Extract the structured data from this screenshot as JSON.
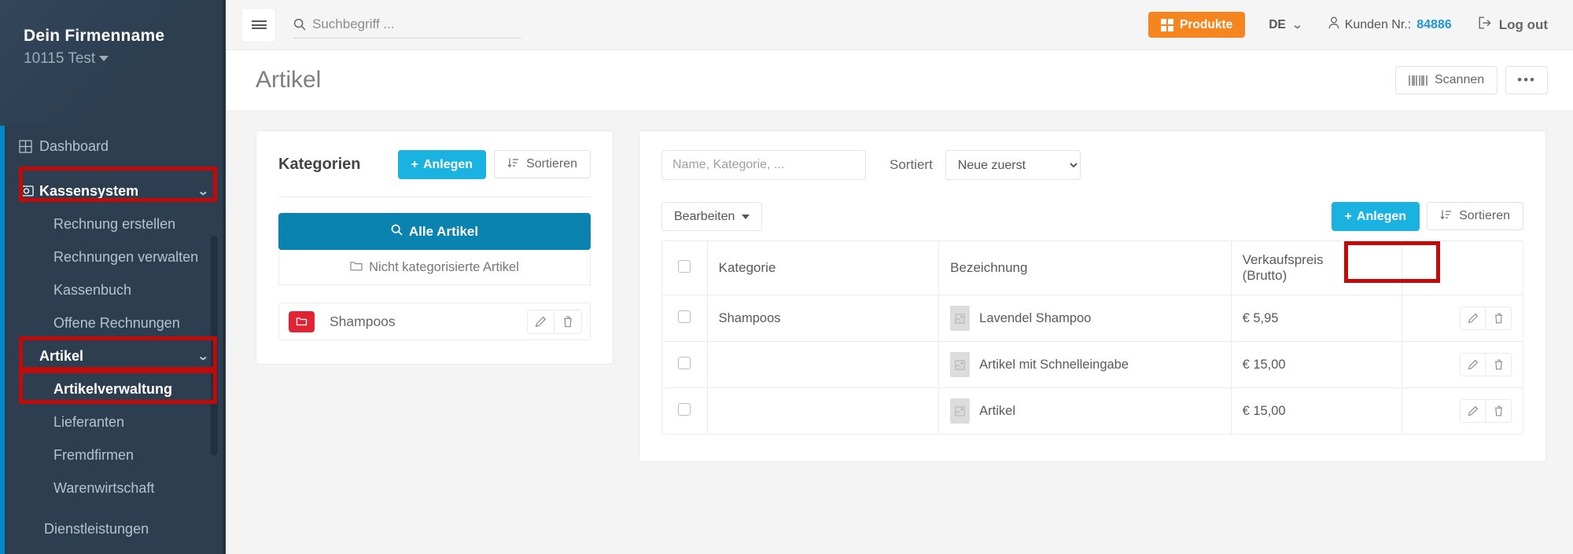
{
  "sidebar": {
    "brand_name": "Dein Firmenname",
    "brand_sub": "10115 Test",
    "items": [
      {
        "label": "Dashboard",
        "icon": "dashboard-grid-icon",
        "type": "top"
      },
      {
        "label": "Kassensystem",
        "icon": "cash-note-icon",
        "type": "parent",
        "chevron": "⌄",
        "highlighted": true
      },
      {
        "label": "Rechnung erstellen",
        "type": "sub"
      },
      {
        "label": "Rechnungen verwalten",
        "type": "sub"
      },
      {
        "label": "Kassenbuch",
        "type": "sub"
      },
      {
        "label": "Offene Rechnungen",
        "type": "sub"
      },
      {
        "label": "Artikel",
        "type": "parent",
        "chevron": "⌄",
        "highlighted": true
      },
      {
        "label": "Artikelverwaltung",
        "type": "sub",
        "active": true,
        "highlighted": true
      },
      {
        "label": "Lieferanten",
        "type": "sub"
      },
      {
        "label": "Fremdfirmen",
        "type": "sub"
      },
      {
        "label": "Warenwirtschaft",
        "type": "sub"
      },
      {
        "label": "Dienstleistungen",
        "type": "sub"
      }
    ]
  },
  "topbar": {
    "menu_icon": "hamburger-icon",
    "search_placeholder": "Suchbegriff ...",
    "search_value": "",
    "produkte_label": "Produkte",
    "language": "DE",
    "customer_label": "Kunden Nr.:",
    "customer_number": "84886",
    "logout_label": "Log out"
  },
  "pagehead": {
    "title": "Artikel",
    "scan_label": "Scannen",
    "more_label": "•••"
  },
  "categories": {
    "title": "Kategorien",
    "create_label": "Anlegen",
    "sort_label": "Sortieren",
    "all_articles_label": "Alle Artikel",
    "uncategorized_label": "Nicht kategorisierte Artikel",
    "items": [
      {
        "name": "Shampoos",
        "color": "#e02436"
      }
    ]
  },
  "articles": {
    "search_placeholder": "Name, Kategorie, ...",
    "search_value": "",
    "sort_label": "Sortiert",
    "sort_value": "Neue zuerst",
    "sort_options": [
      "Neue zuerst"
    ],
    "edit_dropdown_label": "Bearbeiten",
    "create_label": "Anlegen",
    "sort_button_label": "Sortieren",
    "columns": [
      "",
      "Kategorie",
      "Bezeichnung",
      "Verkaufspreis (Brutto)",
      ""
    ],
    "column_price_line1": "Verkaufspreis",
    "column_price_line2": "(Brutto)",
    "rows": [
      {
        "category": "Shampoos",
        "name": "Lavendel Shampoo",
        "price": "€ 5,95"
      },
      {
        "category": "",
        "name": "Artikel mit Schnelleingabe",
        "price": "€ 15,00"
      },
      {
        "category": "",
        "name": "Artikel",
        "price": "€ 15,00"
      }
    ]
  },
  "colors": {
    "sidebar_bg": "#2c3e50",
    "accent_blue": "#0088cc",
    "primary_cyan": "#1ab2e0",
    "deep_blue": "#0a83b0",
    "orange": "#f5861f",
    "annotation_red": "#c10b0b",
    "folder_red": "#e02436"
  }
}
